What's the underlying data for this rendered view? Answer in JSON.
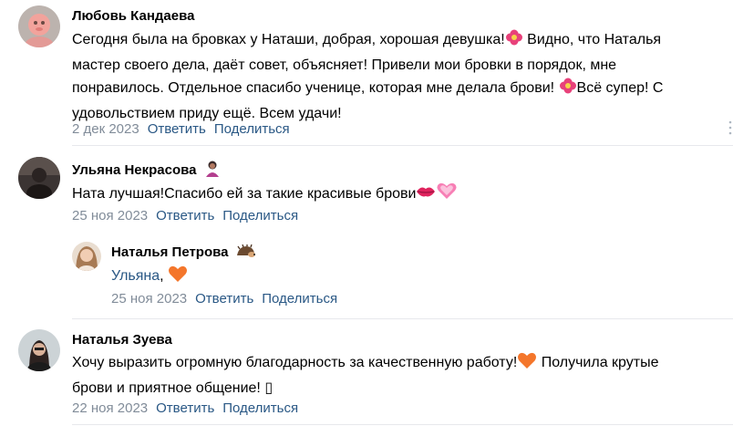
{
  "comments": [
    {
      "author": "Любовь Кандаева",
      "lines": [
        "Сегодня была на бровках у Наташи, добрая, хорошая девушка!",
        " Видно, что Наталья",
        "мастер своего дела, даёт совет, объясняет! Привели мои бровки в порядок, мне",
        "понравилось. Отдельное спасибо ученице, которая мне делала брови! ",
        "Всё супер! С",
        "удовольствием приду ещё. Всем удачи!"
      ],
      "date": "2 дек 2023",
      "reply_label": "Ответить",
      "share_label": "Поделиться",
      "emojis": [
        "hibiscus-icon",
        "hibiscus-icon"
      ]
    },
    {
      "author": "Ульяна Некрасова",
      "author_badge": "person-emoji-icon",
      "text": "Ната лучшая!Спасибо ей за такие красивые брови",
      "date": "25 ноя 2023",
      "reply_label": "Ответить",
      "share_label": "Поделиться",
      "emojis": [
        "kiss-lips-icon",
        "sparkling-heart-icon"
      ]
    },
    {
      "author": "Наталья Петрова",
      "author_badge": "hedgehog-icon",
      "reply_to": "Ульяна",
      "reply_suffix": ",",
      "date": "25 ноя 2023",
      "reply_label": "Ответить",
      "share_label": "Поделиться",
      "emojis": [
        "orange-heart-icon"
      ]
    },
    {
      "author": "Наталья Зуева",
      "line1": "Хочу выразить огромную благодарность за качественную работу!",
      "line1_tail": " Получила крутые",
      "line2": "брови и приятное общение! ",
      "line2_glyph": "▯",
      "date": "22 ноя 2023",
      "reply_label": "Ответить",
      "share_label": "Поделиться",
      "emojis": [
        "orange-heart-icon"
      ]
    }
  ],
  "colors": {
    "link": "#2a5885",
    "date": "#818c99",
    "divider": "#e7e8ec",
    "text": "#000000"
  }
}
